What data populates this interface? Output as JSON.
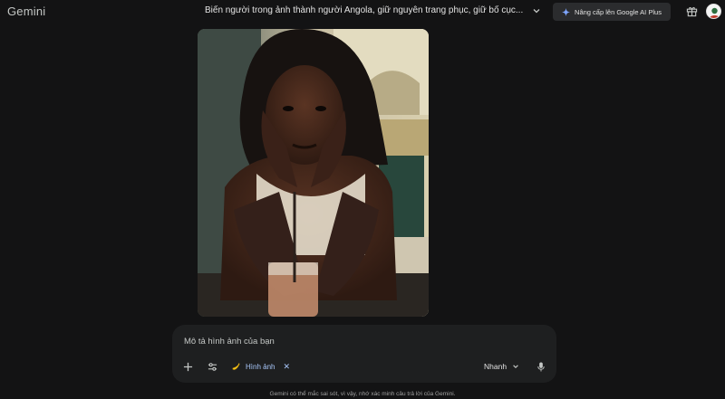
{
  "header": {
    "logo": "Gemini",
    "chat_title": "Biến người trong ảnh thành người Angola, giữ nguyên trang phục, giữ bố cục...",
    "upgrade_label": "Nâng cấp lên Google AI Plus"
  },
  "prompt": {
    "placeholder": "Mô tả hình ảnh của bạn",
    "image_chip_label": "Hình ảnh",
    "model_label": "Nhanh"
  },
  "footer": {
    "disclaimer": "Gemini có thể mắc sai sót, vì vậy, nhớ xác minh câu trả lời của Gemini."
  },
  "colors": {
    "background": "#131314",
    "surface": "#1e1f20",
    "accent": "#a8c7fa"
  },
  "icons": [
    "chevron-down-icon",
    "sparkle-icon",
    "gift-icon",
    "plus-icon",
    "tune-icon",
    "banana-icon",
    "close-icon",
    "mic-icon"
  ]
}
